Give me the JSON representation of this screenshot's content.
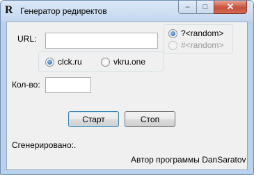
{
  "window": {
    "title": "Генератор редиректов",
    "icon": "R",
    "controls": {
      "minimize": "–",
      "maximize": "□",
      "close": "✕"
    }
  },
  "form": {
    "url_label": "URL:",
    "url_value": "",
    "count_label": "Кол-во:",
    "count_value": "",
    "domain_options": [
      {
        "label": "clck.ru",
        "checked": true
      },
      {
        "label": "vkru.one",
        "checked": false
      }
    ],
    "random_options": [
      {
        "label": "?<random>",
        "checked": true,
        "enabled": true
      },
      {
        "label": "#<random>",
        "checked": false,
        "enabled": false
      }
    ],
    "start_label": "Старт",
    "stop_label": "Стоп"
  },
  "status": {
    "generated_label": "Сгенерировано:",
    "generated_value": ".",
    "author": "Автор программы DanSaratov"
  }
}
